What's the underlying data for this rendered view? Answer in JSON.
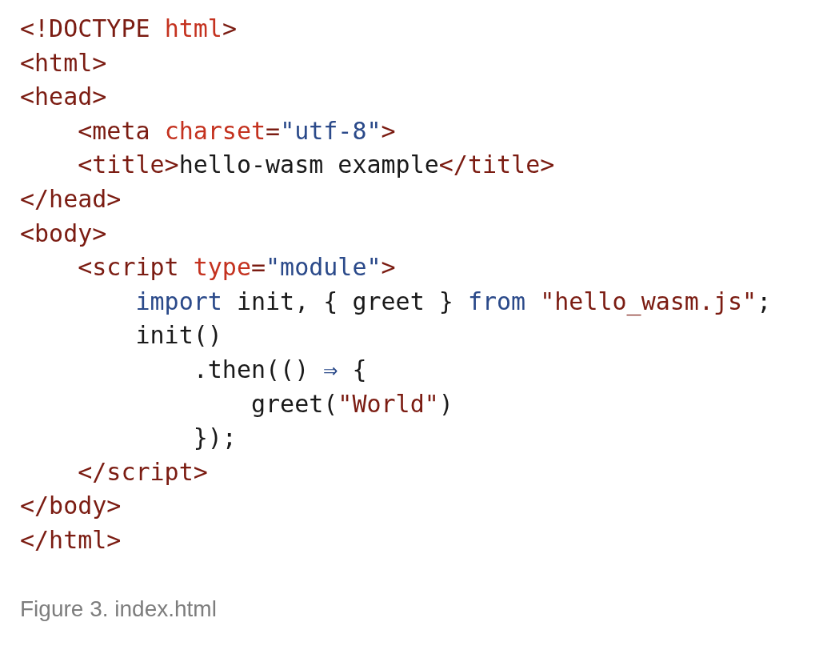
{
  "code_lines": [
    [
      {
        "kind": "tag",
        "text": "<!DOCTYPE "
      },
      {
        "kind": "attr",
        "text": "html"
      },
      {
        "kind": "tag",
        "text": ">"
      }
    ],
    [
      {
        "kind": "tag",
        "text": "<html>"
      }
    ],
    [
      {
        "kind": "tag",
        "text": "<head>"
      }
    ],
    [
      {
        "kind": "tag",
        "text": "    <meta "
      },
      {
        "kind": "attr",
        "text": "charset"
      },
      {
        "kind": "tag",
        "text": "="
      },
      {
        "kind": "value",
        "text": "\"utf-8\""
      },
      {
        "kind": "tag",
        "text": ">"
      }
    ],
    [
      {
        "kind": "tag",
        "text": "    <title>"
      },
      {
        "kind": "text",
        "text": "hello-wasm example"
      },
      {
        "kind": "tag",
        "text": "</title>"
      }
    ],
    [
      {
        "kind": "tag",
        "text": "</head>"
      }
    ],
    [
      {
        "kind": "tag",
        "text": "<body>"
      }
    ],
    [
      {
        "kind": "tag",
        "text": "    <script "
      },
      {
        "kind": "attr",
        "text": "type"
      },
      {
        "kind": "tag",
        "text": "="
      },
      {
        "kind": "value",
        "text": "\"module\""
      },
      {
        "kind": "tag",
        "text": ">"
      }
    ],
    [
      {
        "kind": "keyword",
        "text": "        import"
      },
      {
        "kind": "text",
        "text": " init, { greet } "
      },
      {
        "kind": "keyword",
        "text": "from"
      },
      {
        "kind": "string",
        "text": " \"hello_wasm.js\""
      },
      {
        "kind": "text",
        "text": ";"
      }
    ],
    [
      {
        "kind": "text",
        "text": "        init()"
      }
    ],
    [
      {
        "kind": "text",
        "text": "            .then(() "
      },
      {
        "kind": "keyword",
        "text": "⇒"
      },
      {
        "kind": "text",
        "text": " {"
      }
    ],
    [
      {
        "kind": "text",
        "text": "                greet("
      },
      {
        "kind": "string",
        "text": "\"World\""
      },
      {
        "kind": "text",
        "text": ")"
      }
    ],
    [
      {
        "kind": "text",
        "text": "            });"
      }
    ],
    [
      {
        "kind": "tag",
        "text": "    </script>"
      }
    ],
    [
      {
        "kind": "tag",
        "text": "</body>"
      }
    ],
    [
      {
        "kind": "tag",
        "text": "</html>"
      }
    ]
  ],
  "caption": "Figure 3. index.html"
}
